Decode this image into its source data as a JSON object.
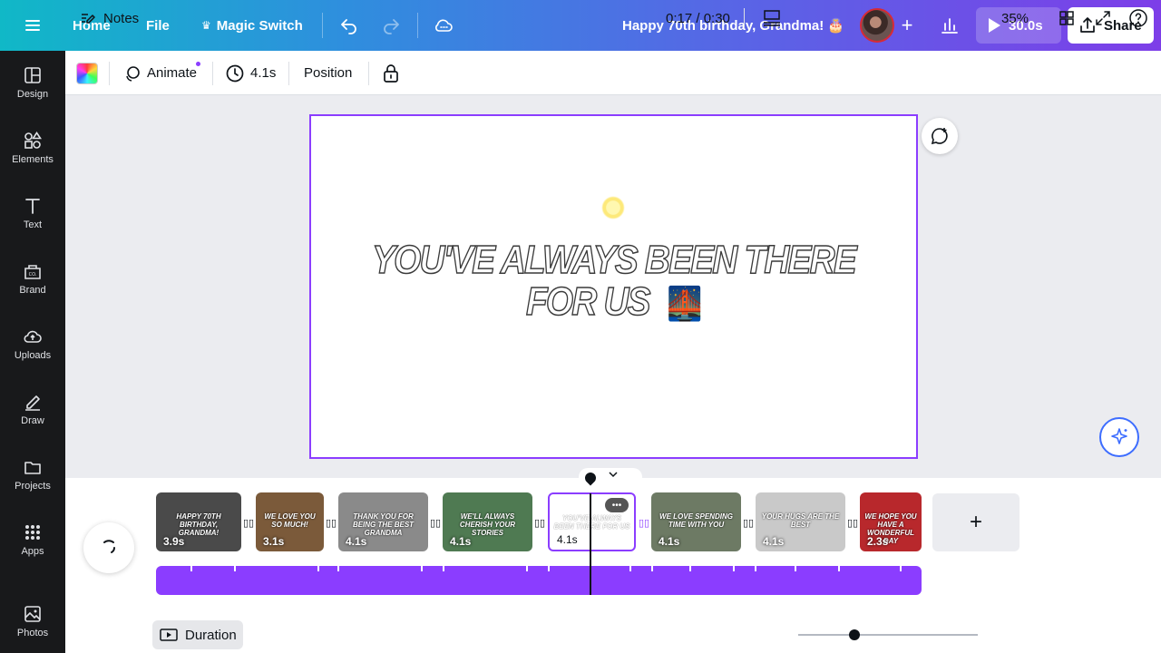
{
  "topbar": {
    "home": "Home",
    "file": "File",
    "magic_switch": "Magic Switch",
    "title": "Happy 70th birthday, Grandma! 🎂",
    "play_duration": "30.0s",
    "share": "Share"
  },
  "sidebar": {
    "items": [
      {
        "label": "Design",
        "icon": "design-icon"
      },
      {
        "label": "Elements",
        "icon": "elements-icon"
      },
      {
        "label": "Text",
        "icon": "text-icon"
      },
      {
        "label": "Brand",
        "icon": "brand-icon"
      },
      {
        "label": "Uploads",
        "icon": "uploads-icon"
      },
      {
        "label": "Draw",
        "icon": "draw-icon"
      },
      {
        "label": "Projects",
        "icon": "projects-icon"
      },
      {
        "label": "Apps",
        "icon": "apps-icon"
      },
      {
        "label": "Photos",
        "icon": "photos-icon"
      }
    ]
  },
  "toolbar": {
    "animate": "Animate",
    "duration": "4.1s",
    "position": "Position"
  },
  "canvas": {
    "headline_line1": "YOU'VE ALWAYS BEEN THERE",
    "headline_line2": "FOR US",
    "emoji": "🌉"
  },
  "timeline": {
    "pages": [
      {
        "duration": "3.9s",
        "caption": "Happy 70th birthday, Grandma!",
        "bg": "#4a4a4a"
      },
      {
        "duration": "3.1s",
        "caption": "We love you so much!",
        "bg": "#7b5a3a"
      },
      {
        "duration": "4.1s",
        "caption": "Thank you for being the best grandma",
        "bg": "#8a8a8a"
      },
      {
        "duration": "4.1s",
        "caption": "We'll always cherish your stories",
        "bg": "#4f7a52"
      },
      {
        "duration": "4.1s",
        "caption": "You've always been there for us",
        "bg": "#ffffff"
      },
      {
        "duration": "4.1s",
        "caption": "We love spending time with you",
        "bg": "#6d7a64"
      },
      {
        "duration": "4.1s",
        "caption": "Your hugs are the best",
        "bg": "#c9c9c9"
      },
      {
        "duration": "2.3s",
        "caption": "We hope you have a wonderful day",
        "bg": "#b8282c"
      }
    ]
  },
  "footer": {
    "notes": "Notes",
    "duration": "Duration",
    "time": "0:17 / 0:30",
    "zoom": "35%",
    "zoom_level": 0.28
  },
  "colors": {
    "accent": "#8b3dff",
    "sidebar_bg": "#18191b"
  }
}
